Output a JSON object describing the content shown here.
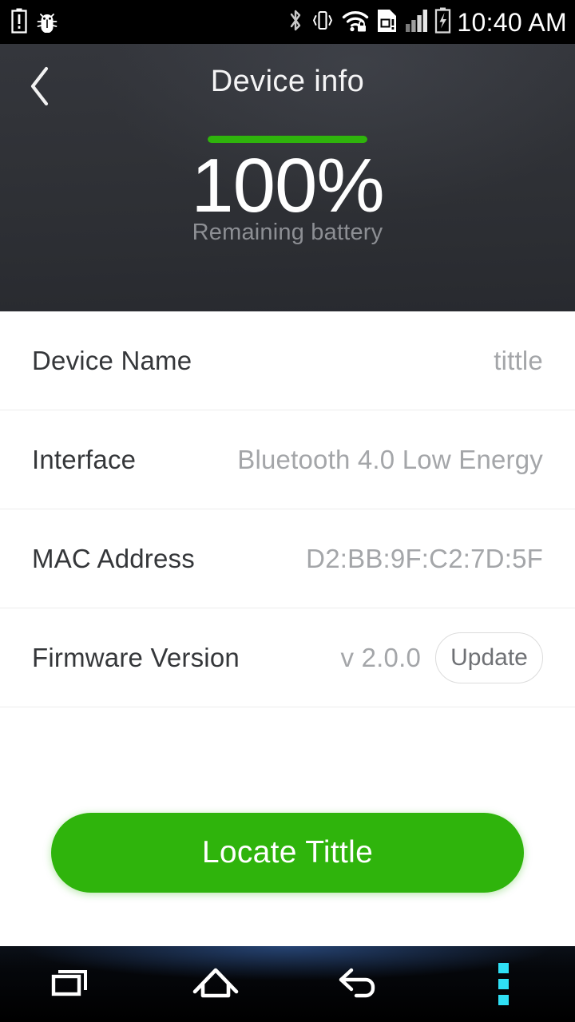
{
  "statusbar": {
    "time": "10:40 AM",
    "left_icons": [
      "battery-alert-icon",
      "android-bug-icon"
    ],
    "right_icons": [
      "bluetooth-icon",
      "vibrate-icon",
      "wifi-secure-icon",
      "sim-card-alert-icon",
      "signal-bars-icon",
      "battery-charging-icon"
    ]
  },
  "header": {
    "title": "Device info",
    "back_icon": "chevron-left-icon",
    "battery": {
      "percent_label": "100%",
      "percent_value": 100,
      "caption": "Remaining battery",
      "bar_color": "#2fb40c",
      "track_color": "#2b2d32"
    },
    "background_color": "#2e3035"
  },
  "info_rows": [
    {
      "label": "Device Name",
      "value": "tittle"
    },
    {
      "label": "Interface",
      "value": "Bluetooth 4.0 Low Energy"
    },
    {
      "label": "MAC Address",
      "value": "D2:BB:9F:C2:7D:5F"
    },
    {
      "label": "Firmware Version",
      "value": "v 2.0.0",
      "action_label": "Update"
    }
  ],
  "locate": {
    "label": "Locate Tittle",
    "color": "#2fb40c"
  },
  "navbar": {
    "recents_icon": "recents-icon",
    "home_icon": "home-icon",
    "back_icon": "back-arrow-icon",
    "menu_icon": "overflow-menu-icon",
    "menu_color": "#2fe0f5"
  }
}
